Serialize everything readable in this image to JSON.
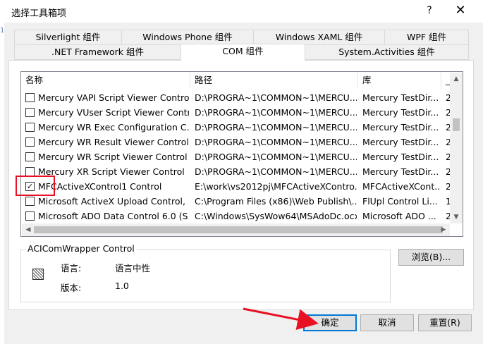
{
  "window": {
    "title": "选择工具箱项",
    "help_label": "?",
    "close_label": "✕",
    "left_marks": [
      "1",
      "1"
    ]
  },
  "tabs_row1": [
    "Silverlight 组件",
    "Windows Phone 组件",
    "Windows XAML 组件",
    "WPF 组件"
  ],
  "tabs_row2": [
    ".NET Framework 组件",
    "COM 组件",
    "System.Activities 组件"
  ],
  "active_tab": "COM 组件",
  "list": {
    "headers": [
      "名称",
      "路径",
      "库",
      "_"
    ],
    "rows": [
      {
        "checked": false,
        "name": "Mercury VAPI Script Viewer Control",
        "path": "D:\\PROGRA~1\\COMMON~1\\MERCU...",
        "lib": "Mercury TestDir...",
        "extra": "2"
      },
      {
        "checked": false,
        "name": "Mercury VUser Script Viewer Contr...",
        "path": "D:\\PROGRA~1\\COMMON~1\\MERCU...",
        "lib": "Mercury TestDir...",
        "extra": "2"
      },
      {
        "checked": false,
        "name": "Mercury WR Exec Configuration C...",
        "path": "D:\\PROGRA~1\\COMMON~1\\MERCU...",
        "lib": "Mercury TestDir...",
        "extra": "2"
      },
      {
        "checked": false,
        "name": "Mercury WR Result Viewer Control",
        "path": "D:\\PROGRA~1\\COMMON~1\\MERCU...",
        "lib": "Mercury TestDir...",
        "extra": "2"
      },
      {
        "checked": false,
        "name": "Mercury WR Script Viewer Control",
        "path": "D:\\PROGRA~1\\COMMON~1\\MERCU...",
        "lib": "Mercury TestDir...",
        "extra": "2"
      },
      {
        "checked": false,
        "name": "Mercury XR Script Viewer Control",
        "path": "D:\\PROGRA~1\\COMMON~1\\MERCU...",
        "lib": "Mercury TestDir...",
        "extra": "2"
      },
      {
        "checked": true,
        "name": "MFCActiveXControl1 Control",
        "path": "E:\\work\\vs2012pj\\MFCActiveXContro...",
        "lib": "MFCActiveXCont...",
        "extra": "2"
      },
      {
        "checked": false,
        "name": "Microsoft ActiveX Upload Control, ...",
        "path": "C:\\Program Files (x86)\\Web Publish\\...",
        "lib": "FlUpl Control Li...",
        "extra": "1"
      },
      {
        "checked": false,
        "name": "Microsoft ADO Data Control 6.0 (S...",
        "path": "C:\\Windows\\SysWow64\\MSAdoDc.ocx",
        "lib": "Microsoft ADO ...",
        "extra": "2"
      }
    ]
  },
  "info": {
    "group_title": "ACIComWrapper Control",
    "language_label": "语言:",
    "language_value": "语言中性",
    "version_label": "版本:",
    "version_value": "1.0"
  },
  "buttons": {
    "browse": "浏览(B)...",
    "ok": "确定",
    "cancel": "取消",
    "reset": "重置(R)"
  },
  "colors": {
    "highlight_box": "#e81123",
    "annotation_arrow": "#e81123",
    "default_button_border": "#0078d7"
  }
}
